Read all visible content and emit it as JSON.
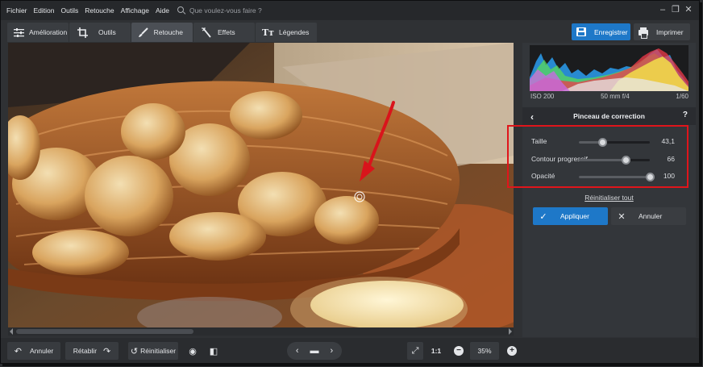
{
  "menu": {
    "items": [
      "Fichier",
      "Edition",
      "Outils",
      "Retouche",
      "Affichage",
      "Aide"
    ],
    "search_placeholder": "Que voulez-vous faire ?"
  },
  "window_controls": [
    "–",
    "❐",
    "✕"
  ],
  "tabs": [
    {
      "label": "Amélioration",
      "icon": "sliders-icon",
      "active": false
    },
    {
      "label": "Outils",
      "icon": "crop-icon",
      "active": false
    },
    {
      "label": "Retouche",
      "icon": "brush-icon",
      "active": true
    },
    {
      "label": "Effets",
      "icon": "magic-wand-icon",
      "active": false
    },
    {
      "label": "Légendes",
      "icon": "text-icon",
      "active": false
    }
  ],
  "actions": {
    "save_label": "Enregistrer",
    "print_label": "Imprimer"
  },
  "camera": {
    "iso": "ISO 200",
    "lens": "50 mm f/4",
    "shutter": "1/60"
  },
  "panel": {
    "title": "Pinceau de correction",
    "help": "?",
    "sliders": [
      {
        "label": "Taille",
        "value": "43,1",
        "level": 0.33
      },
      {
        "label": "Contour progressif",
        "value": "66",
        "level": 0.66
      },
      {
        "label": "Opacité",
        "value": "100",
        "level": 1.0
      }
    ],
    "reset_label": "Réinitialiser tout",
    "apply_label": "Appliquer",
    "cancel_label": "Annuler"
  },
  "bottom": {
    "undo_label": "Annuler",
    "redo_label": "Rétablir",
    "reset_label": "Réinitialiser",
    "one_to_one": "1:1",
    "zoom": "35%"
  },
  "colors": {
    "accent": "#1e78c8",
    "highlight": "#e0151b"
  }
}
